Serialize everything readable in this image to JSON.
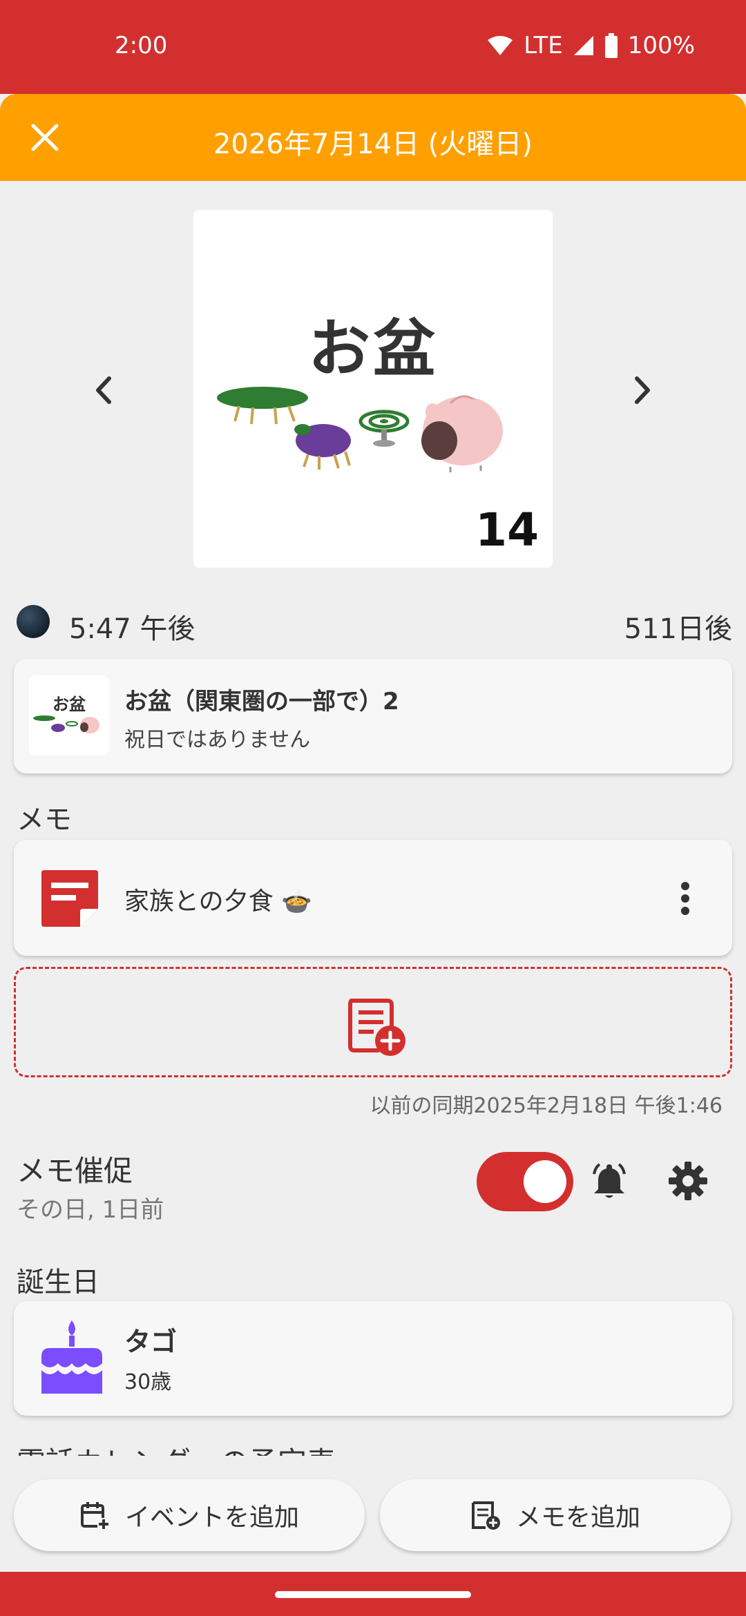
{
  "status_bar": {
    "time": "2:00",
    "network": "LTE",
    "battery": "100%"
  },
  "header": {
    "title": "2026年7月14日 (火曜日)",
    "close_icon": "close-icon"
  },
  "hero": {
    "title": "お盆",
    "day_number": "14"
  },
  "moon": {
    "time": "5:47 午後",
    "days_until": "511日後"
  },
  "holiday": {
    "thumb_text": "お盆",
    "name": "お盆（関東圏の一部で）2",
    "status": "祝日ではありません"
  },
  "memo_section": {
    "label": "メモ",
    "item_text": "家族との夕食 🍲",
    "previous_sync": "以前の同期2025年2月18日 午後1:46"
  },
  "reminder": {
    "title": "メモ催促",
    "subtitle": "その日, 1日前",
    "enabled": true
  },
  "birthday_section": {
    "label": "誕生日",
    "name": "タゴ",
    "age": "30歳"
  },
  "calendar_section": {
    "label": "電話カレンダーの予定表"
  },
  "actions": {
    "add_event": "イベントを追加",
    "add_memo": "メモを追加"
  },
  "colors": {
    "status_bar": "#d32f2f",
    "header": "#ffa000",
    "accent": "#d32f2f",
    "birthday_icon": "#7c4dff"
  }
}
